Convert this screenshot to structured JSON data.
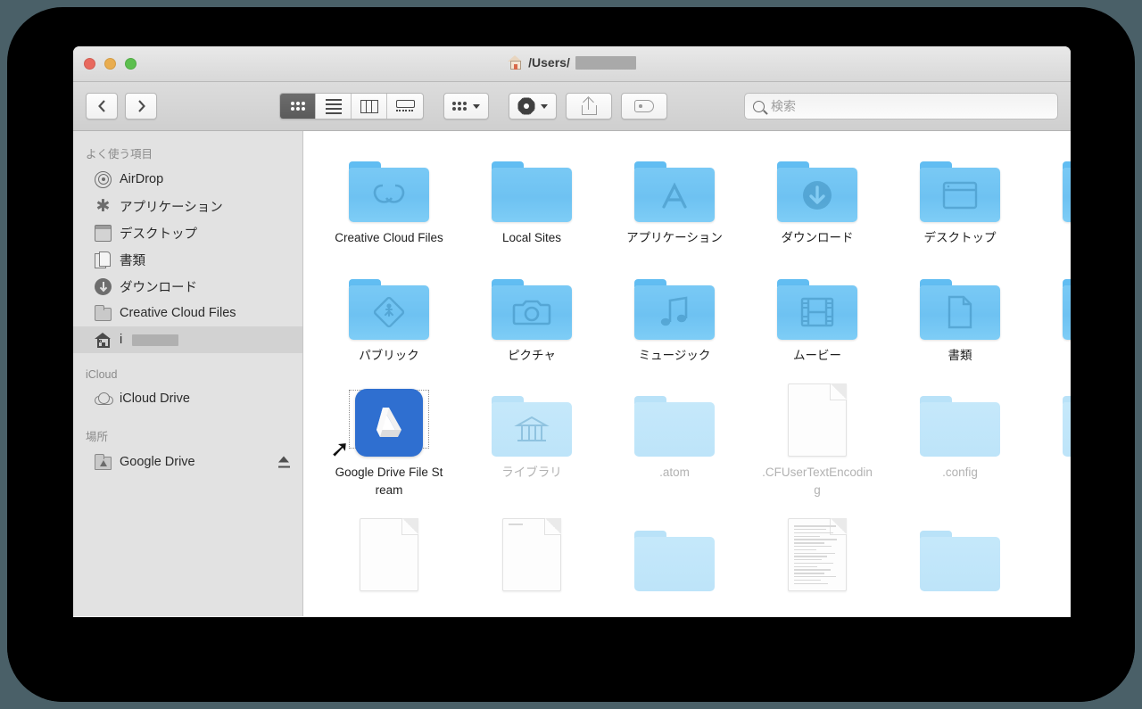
{
  "window": {
    "title_prefix": "/Users/",
    "title_redacted": true,
    "home_icon": "home-icon",
    "traffic_lights": {
      "close": "#e8695e",
      "minimize": "#e9ad4f",
      "maximize": "#5cbf4e"
    }
  },
  "toolbar": {
    "back_label": "‹",
    "forward_label": "›",
    "view_modes": [
      {
        "name": "icon-view",
        "icon": "grid-icon",
        "active": true
      },
      {
        "name": "list-view",
        "icon": "list-icon",
        "active": false
      },
      {
        "name": "column-view",
        "icon": "columns-icon",
        "active": false
      },
      {
        "name": "gallery-view",
        "icon": "coverflow-icon",
        "active": false
      }
    ],
    "arrange": {
      "name": "arrange-button",
      "icon": "grid-icon"
    },
    "action": {
      "name": "action-button",
      "icon": "gear-icon"
    },
    "share": {
      "name": "share-button",
      "icon": "share-icon"
    },
    "tags": {
      "name": "tags-button",
      "icon": "tag-icon"
    }
  },
  "search": {
    "placeholder": "検索",
    "value": "",
    "icon": "search-icon"
  },
  "sidebar": {
    "sections": [
      {
        "header": "よく使う項目",
        "items": [
          {
            "label": "AirDrop",
            "icon": "airdrop-icon",
            "selected": false
          },
          {
            "label": "アプリケーション",
            "icon": "applications-icon",
            "selected": false
          },
          {
            "label": "デスクトップ",
            "icon": "desktop-icon",
            "selected": false
          },
          {
            "label": "書類",
            "icon": "documents-icon",
            "selected": false
          },
          {
            "label": "ダウンロード",
            "icon": "downloads-icon",
            "selected": false
          },
          {
            "label": "Creative Cloud Files",
            "icon": "folder-icon",
            "selected": false
          },
          {
            "label": "i",
            "icon": "home-icon",
            "selected": true,
            "redacted": true
          }
        ]
      },
      {
        "header": "iCloud",
        "items": [
          {
            "label": "iCloud Drive",
            "icon": "cloud-icon",
            "selected": false
          }
        ]
      },
      {
        "header": "場所",
        "items": [
          {
            "label": "Google Drive",
            "icon": "google-drive-folder-icon",
            "selected": false,
            "eject": true
          }
        ]
      }
    ]
  },
  "content": {
    "items": [
      {
        "label": "Creative Cloud Files",
        "kind": "folder",
        "glyph": "creative-cloud-icon",
        "dim": false,
        "selected": false
      },
      {
        "label": "Local Sites",
        "kind": "folder",
        "glyph": "none",
        "dim": false,
        "selected": false
      },
      {
        "label": "アプリケーション",
        "kind": "folder",
        "glyph": "appstore-icon",
        "dim": false,
        "selected": false
      },
      {
        "label": "ダウンロード",
        "kind": "folder",
        "glyph": "download-arrow-icon",
        "dim": false,
        "selected": false
      },
      {
        "label": "デスクトップ",
        "kind": "folder",
        "glyph": "window-icon",
        "dim": false,
        "selected": false
      },
      {
        "label": "",
        "kind": "folder",
        "glyph": "none",
        "dim": false,
        "selected": false,
        "partial": true
      },
      {
        "label": "パブリック",
        "kind": "folder",
        "glyph": "public-walker-icon",
        "dim": false,
        "selected": false
      },
      {
        "label": "ピクチャ",
        "kind": "folder",
        "glyph": "camera-icon",
        "dim": false,
        "selected": false
      },
      {
        "label": "ミュージック",
        "kind": "folder",
        "glyph": "music-note-icon",
        "dim": false,
        "selected": false
      },
      {
        "label": "ムービー",
        "kind": "folder",
        "glyph": "film-icon",
        "dim": false,
        "selected": false
      },
      {
        "label": "書類",
        "kind": "folder",
        "glyph": "page-icon",
        "dim": false,
        "selected": false
      },
      {
        "label": "",
        "kind": "folder",
        "glyph": "none",
        "dim": false,
        "selected": false,
        "partial": true
      },
      {
        "label": "Google Drive File Stream",
        "kind": "app",
        "glyph": "google-drive-icon",
        "dim": false,
        "selected": true,
        "alias": true
      },
      {
        "label": "ライブラリ",
        "kind": "folder",
        "glyph": "library-columns-icon",
        "dim": true,
        "selected": false
      },
      {
        "label": ".atom",
        "kind": "folder",
        "glyph": "none",
        "dim": true,
        "selected": false
      },
      {
        "label": ".CFUserTextEncoding",
        "kind": "document",
        "glyph": "blank-page-icon",
        "dim": true,
        "selected": false
      },
      {
        "label": ".config",
        "kind": "folder",
        "glyph": "none",
        "dim": true,
        "selected": false
      },
      {
        "label": "",
        "kind": "folder",
        "glyph": "none",
        "dim": true,
        "selected": false,
        "partial": true
      },
      {
        "label": "",
        "kind": "document",
        "glyph": "blank-page-icon",
        "dim": true,
        "selected": false,
        "clipped": true
      },
      {
        "label": "",
        "kind": "document",
        "glyph": "blank-page-icon",
        "dim": true,
        "selected": false,
        "clipped": true
      },
      {
        "label": "",
        "kind": "folder",
        "glyph": "none",
        "dim": true,
        "selected": false,
        "clipped": true
      },
      {
        "label": "",
        "kind": "document",
        "glyph": "text-page-icon",
        "dim": true,
        "selected": false,
        "clipped": true
      },
      {
        "label": "",
        "kind": "folder",
        "glyph": "none",
        "dim": true,
        "selected": false,
        "clipped": true
      },
      {
        "label": "",
        "kind": "document",
        "glyph": "blank-page-icon",
        "dim": true,
        "selected": false,
        "clipped": true
      }
    ]
  }
}
